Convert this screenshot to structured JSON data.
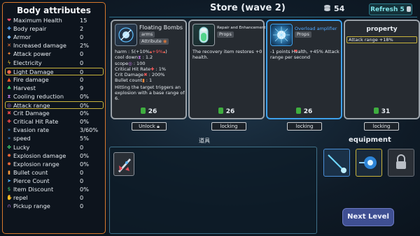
{
  "attributes": {
    "title": "Body attributes",
    "rows": [
      {
        "icon": "heart-icon",
        "glyph": "❤",
        "color": "#ff4b6b",
        "name": "Maximum Health",
        "value": "15"
      },
      {
        "icon": "wrench-icon",
        "glyph": "✚",
        "color": "#4aa3ff",
        "name": "Body repair",
        "value": "2"
      },
      {
        "icon": "shield-icon",
        "glyph": "◆",
        "color": "#6fb9ff",
        "name": "Armor",
        "value": "0"
      },
      {
        "icon": "damage-icon",
        "glyph": "✕",
        "color": "#ff7a3a",
        "name": "Increased damage",
        "value": "2%"
      },
      {
        "icon": "attack-icon",
        "glyph": "✦",
        "color": "#ff8a3a",
        "name": "Attack power",
        "value": "0"
      },
      {
        "icon": "lightning-icon",
        "glyph": "ϟ",
        "color": "#ffd33a",
        "name": "Electricity",
        "value": "0"
      },
      {
        "icon": "light-icon",
        "glyph": "●",
        "color": "#ff6a4a",
        "name": "Light Damage",
        "value": "0"
      },
      {
        "icon": "fire-icon",
        "glyph": "▲",
        "color": "#ff5a2a",
        "name": "Fire damage",
        "value": "0"
      },
      {
        "icon": "harvest-icon",
        "glyph": "♣",
        "color": "#3fd36f",
        "name": "Harvest",
        "value": "9"
      },
      {
        "icon": "hourglass-icon",
        "glyph": "⧗",
        "color": "#c07be6",
        "name": "Cooling reduction",
        "value": "0%"
      },
      {
        "icon": "range-icon",
        "glyph": "◎",
        "color": "#c07be6",
        "name": "Attack range",
        "value": "0%"
      },
      {
        "icon": "crit-damage-icon",
        "glyph": "✖",
        "color": "#ff4b4b",
        "name": "Crit Damage",
        "value": "0%"
      },
      {
        "icon": "crit-rate-icon",
        "glyph": "✚",
        "color": "#ff4b4b",
        "name": "Critical Hit Rate",
        "value": "0%"
      },
      {
        "icon": "evasion-icon",
        "glyph": "»",
        "color": "#52b6ff",
        "name": "Evasion rate",
        "value": "3/60%"
      },
      {
        "icon": "speed-icon",
        "glyph": "»",
        "color": "#4aa3ff",
        "name": "speed",
        "value": "5%"
      },
      {
        "icon": "clover-icon",
        "glyph": "✤",
        "color": "#3fd36f",
        "name": "Lucky",
        "value": "0"
      },
      {
        "icon": "explosion-icon",
        "glyph": "✸",
        "color": "#ff6b3a",
        "name": "Explosion damage",
        "value": "0%"
      },
      {
        "icon": "explosion-range-icon",
        "glyph": "✸",
        "color": "#ff6b3a",
        "name": "Explosion range",
        "value": "0%"
      },
      {
        "icon": "bullet-icon",
        "glyph": "▮",
        "color": "#ff9a3a",
        "name": "Bullet count",
        "value": "0"
      },
      {
        "icon": "pierce-icon",
        "glyph": "➤",
        "color": "#52b6ff",
        "name": "Pierce Count",
        "value": "0"
      },
      {
        "icon": "discount-icon",
        "glyph": "$",
        "color": "#3fd36f",
        "name": "Item Discount",
        "value": "0%"
      },
      {
        "icon": "repel-icon",
        "glyph": "✋",
        "color": "#ff7ab6",
        "name": "repel",
        "value": "0"
      },
      {
        "icon": "magnet-icon",
        "glyph": "∩",
        "color": "#c07be6",
        "name": "Pickup range",
        "value": "0"
      }
    ]
  },
  "header": {
    "store_title": "Store (wave 2)",
    "coins": "54",
    "refresh_label": "Refresh",
    "refresh_cost": "5"
  },
  "cards": [
    {
      "name": "Floating Bombs",
      "category": "arms",
      "tag": "Attribute",
      "stats": [
        {
          "label": "harm : ",
          "value": "5(+10%",
          "extra": "+9%",
          "tail": ")"
        },
        {
          "label": "cool down",
          "value": " : 1.2"
        },
        {
          "label": "scope",
          "value": " : 100"
        },
        {
          "label": "Critical Hit Rate",
          "value": " : 1%"
        },
        {
          "label": "Crit Damage",
          "value": " : 200%"
        },
        {
          "label": "Bullet count",
          "value": " : 1"
        }
      ],
      "description": "Hitting the target triggers an explosion with a base range of 6.",
      "price": "26",
      "button": "Unlock"
    },
    {
      "name": "Repair and Enhancement",
      "category": "Props",
      "description": "The recovery item restores +0 health.",
      "price": "26",
      "button": "locking"
    },
    {
      "name": "Overload amplifier",
      "category": "Props",
      "description": "-1 points Health, +45% Attack range per second",
      "price": "26",
      "button": "locking"
    },
    {
      "name": "property",
      "attribute_line": "Attack range +18%",
      "price": "31",
      "button": "locking"
    }
  ],
  "inventory": {
    "label": "道具",
    "items": [
      {
        "icon": "spaceship-icon"
      }
    ]
  },
  "equipment": {
    "label": "equipment",
    "slots": [
      {
        "icon": "laser-gun-icon"
      },
      {
        "icon": "amplifier-icon"
      },
      {
        "icon": "lock-icon"
      }
    ]
  },
  "next_level_label": "Next Level"
}
